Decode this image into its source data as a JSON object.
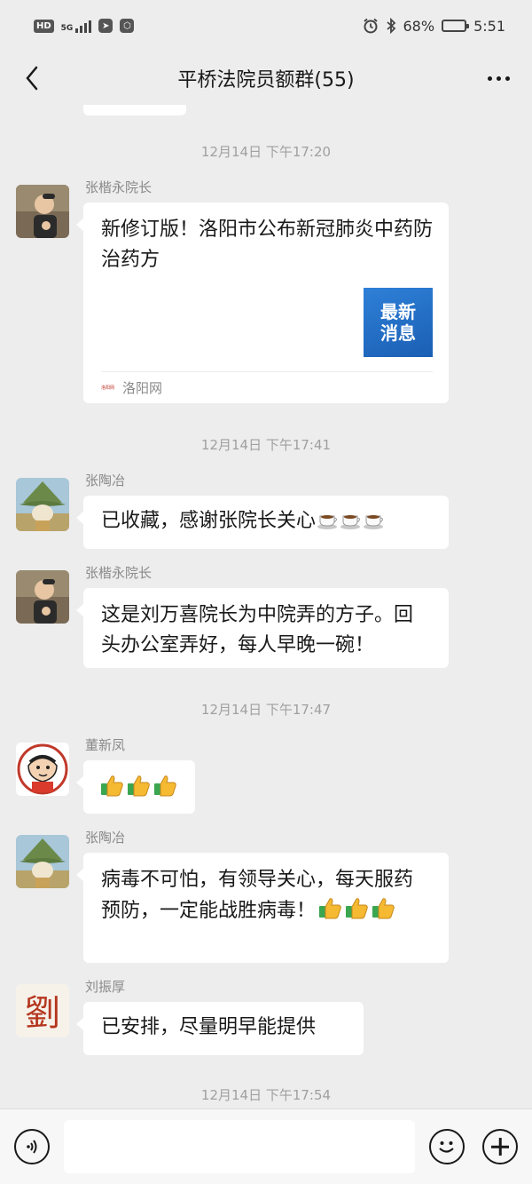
{
  "status_bar": {
    "hd": "HD",
    "network": "5G",
    "battery": "68%",
    "battery_level": 0.68,
    "time": "5:51"
  },
  "nav": {
    "title": "平桥法院员额群(55)"
  },
  "timestamps": [
    "12月14日 下午17:20",
    "12月14日 下午17:41",
    "12月14日 下午17:47",
    "12月14日 下午17:54"
  ],
  "messages": [
    {
      "sender": "张楷永院长",
      "type": "link",
      "title": "新修订版！洛阳市公布新冠肺炎中药防治药方",
      "thumb_text": [
        "最新",
        "消息"
      ],
      "source": "洛阳网",
      "source_logo": "洛阳网"
    },
    {
      "sender": "张陶冶",
      "type": "text",
      "text": "已收藏，感谢张院长关心",
      "emoji": [
        "coffee-emoji",
        "coffee-emoji",
        "coffee-emoji"
      ]
    },
    {
      "sender": "张楷永院长",
      "type": "text",
      "text": "这是刘万喜院长为中院弄的方子。回头办公室弄好，每人早晚一碗！"
    },
    {
      "sender": "董新凤",
      "type": "emoji",
      "emoji": [
        "thumbs-up-emoji",
        "thumbs-up-emoji",
        "thumbs-up-emoji"
      ]
    },
    {
      "sender": "张陶冶",
      "type": "text",
      "text": "病毒不可怕，有领导关心，每天服药预防，一定能战胜病毒！",
      "emoji": [
        "thumbs-up-emoji",
        "thumbs-up-emoji",
        "thumbs-up-emoji"
      ]
    },
    {
      "sender": "刘振厚",
      "type": "text",
      "text": "已安排，尽量明早能提供",
      "avatar_text": "劉"
    }
  ],
  "input_bar": {
    "placeholder": "",
    "icons": [
      "voice-icon",
      "emoji-icon",
      "plus-icon"
    ]
  },
  "colors": {
    "background": "#ededed",
    "bubble": "#ffffff",
    "timestamp": "#a0a0a0",
    "sender": "#8a8a8a",
    "card_thumb": "#1a5fb4"
  }
}
